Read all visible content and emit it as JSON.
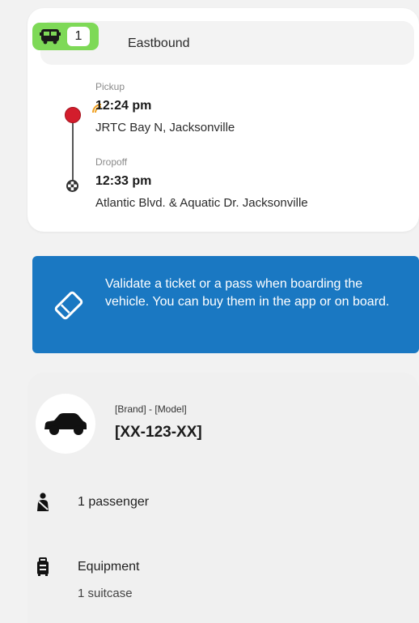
{
  "trip": {
    "line_number": "1",
    "direction": "Eastbound",
    "pickup": {
      "label": "Pickup",
      "time": "12:24 pm",
      "place": "JRTC Bay N, Jacksonville"
    },
    "dropoff": {
      "label": "Dropoff",
      "time": "12:33 pm",
      "place": "Atlantic Blvd. & Aquatic Dr. Jacksonville"
    }
  },
  "info": {
    "text": "Validate a ticket or a pass when boarding the vehicle. You can buy them in the app or on board."
  },
  "vehicle": {
    "brand_model": "[Brand] - [Model]",
    "plate": "[XX-123-XX]"
  },
  "details": {
    "passengers": "1 passenger",
    "equipment_title": "Equipment",
    "equipment_detail": "1 suitcase"
  },
  "icons": {
    "bus": "bus-icon",
    "realtime": "realtime-signal-icon",
    "ticket": "ticket-icon",
    "car": "car-icon",
    "passenger": "passenger-seatbelt-icon",
    "luggage": "luggage-icon"
  },
  "colors": {
    "line_badge": "#7ed957",
    "pickup_dot": "#d31d2c",
    "info_banner": "#1a78c2",
    "realtime": "#f0a020"
  }
}
